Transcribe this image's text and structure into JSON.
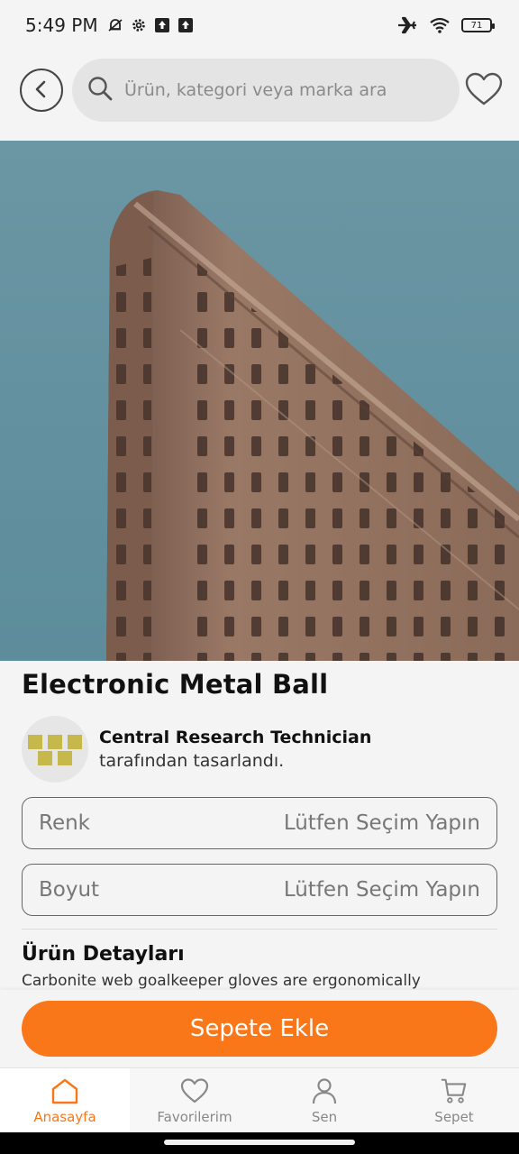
{
  "status_bar": {
    "time": "5:49 PM",
    "battery": "71",
    "left_icons": [
      "mute-bell-icon",
      "gear-icon",
      "upload-icon",
      "upload-icon"
    ],
    "right_icons": [
      "airplane-icon",
      "wifi-icon",
      "battery-icon"
    ]
  },
  "header": {
    "search_placeholder": "Ürün, kategori veya marka ara"
  },
  "product": {
    "title": "Electronic Metal Ball",
    "designer_name": "Central Research Technician",
    "designer_suffix": "tarafından tasarlandı.",
    "color_label": "Renk",
    "color_value": "Lütfen Seçim Yapın",
    "size_label": "Boyut",
    "size_value": "Lütfen Seçim Yapın",
    "details_title": "Ürün Detayları",
    "details_text": "Carbonite web goalkeeper gloves are ergonomically"
  },
  "cart": {
    "add_label": "Sepete Ekle"
  },
  "nav": {
    "items": [
      {
        "label": "Anasayfa",
        "icon": "home-icon",
        "active": true
      },
      {
        "label": "Favorilerim",
        "icon": "heart-icon",
        "active": false
      },
      {
        "label": "Sen",
        "icon": "user-icon",
        "active": false
      },
      {
        "label": "Sepet",
        "icon": "cart-icon",
        "active": false
      }
    ]
  },
  "colors": {
    "accent": "#f97718",
    "background": "#f4f4f4",
    "sky": "#6a95a3",
    "building": "#8a6a58"
  }
}
